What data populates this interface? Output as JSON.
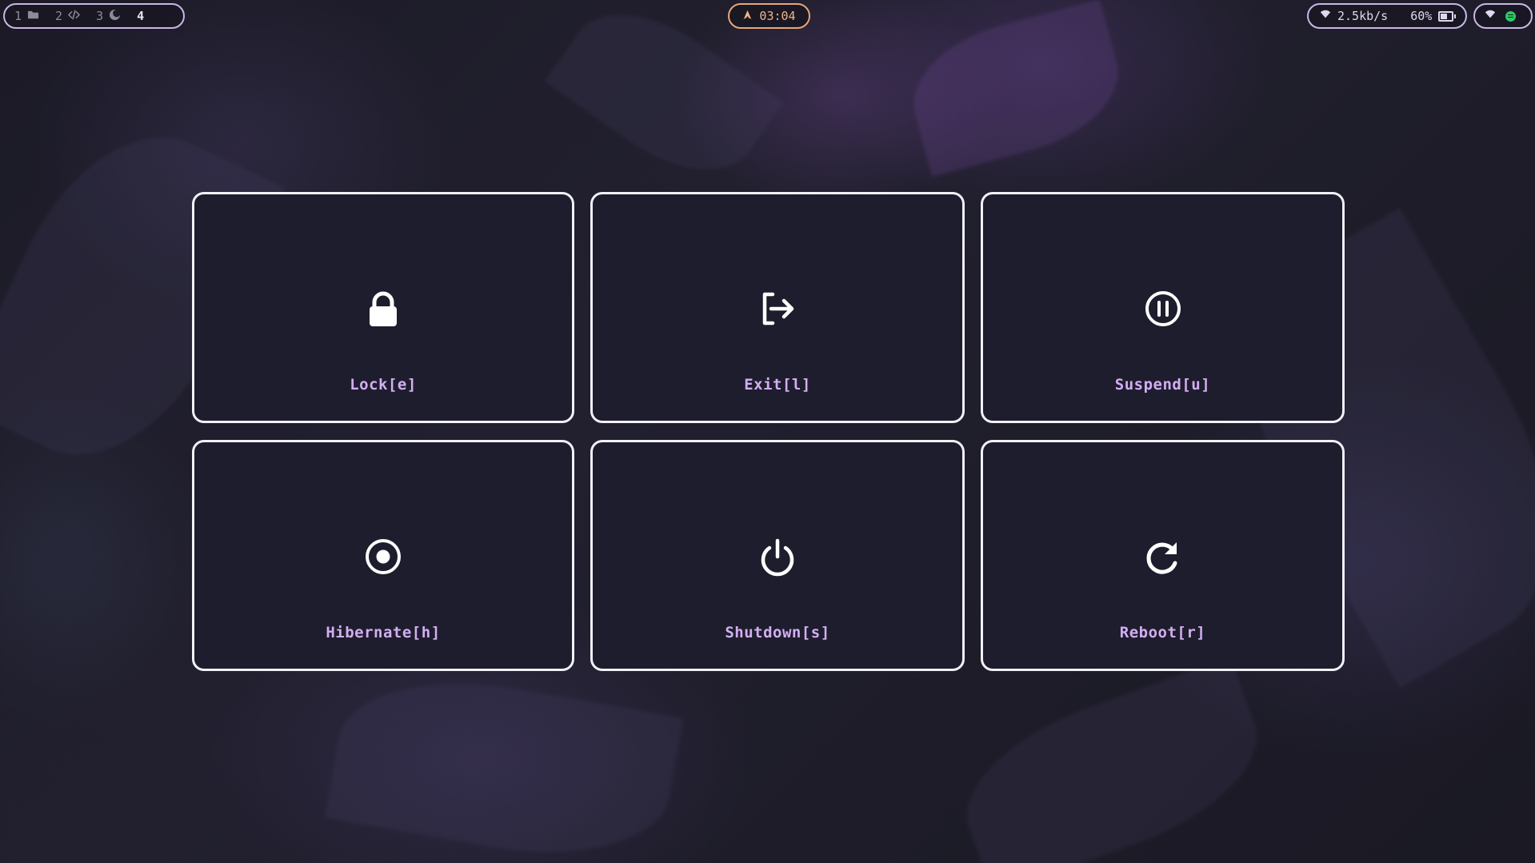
{
  "wallpaper": {
    "description_colors": [
      "#1b1a26",
      "#3a2f55",
      "#2b3a48"
    ]
  },
  "topbar": {
    "workspaces": [
      {
        "number": "1",
        "icon": "folder-icon",
        "active": false
      },
      {
        "number": "2",
        "icon": "code-icon",
        "active": false
      },
      {
        "number": "3",
        "icon": "moon-icon",
        "active": false
      },
      {
        "number": "4",
        "icon": "",
        "active": true
      }
    ],
    "clock": {
      "icon": "arch-icon",
      "time": "03:04",
      "accent": "#e7a67a"
    },
    "network": {
      "icon": "wifi-icon",
      "speed": "2.5kb/s"
    },
    "battery": {
      "percent_label": "60%",
      "level": 0.6
    },
    "tray": {
      "wifi_icon": "wifi-icon",
      "spotify_icon": "spotify-icon",
      "spotify_color": "#2ec866"
    }
  },
  "power_menu": {
    "accent_label_color": "#d2aef2",
    "border_color": "#f2f0f7",
    "tile_bg": "#1e1d2d",
    "items": [
      {
        "label": "Lock[e]",
        "icon": "lock-icon"
      },
      {
        "label": "Exit[l]",
        "icon": "logout-icon"
      },
      {
        "label": "Suspend[u]",
        "icon": "pause-circle-icon"
      },
      {
        "label": "Hibernate[h]",
        "icon": "record-circle-icon"
      },
      {
        "label": "Shutdown[s]",
        "icon": "power-icon"
      },
      {
        "label": "Reboot[r]",
        "icon": "reload-icon"
      }
    ]
  }
}
